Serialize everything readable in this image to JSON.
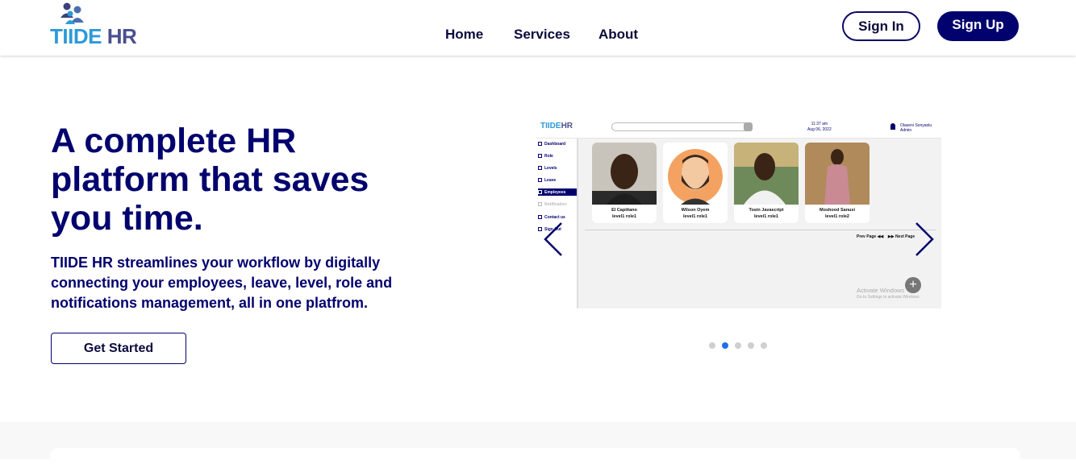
{
  "header": {
    "logo_part1": "TIIDE",
    "logo_part2": "HR",
    "nav": [
      "Home",
      "Services",
      "About"
    ],
    "signin_label": "Sign In",
    "signup_label": "Sign Up"
  },
  "hero": {
    "title": "A complete HR platform that saves you time.",
    "description": "TIIDE HR streamlines your workflow by digitally connecting your employees, leave, level, role and notifications management, all in one platfrom.",
    "cta_label": "Get Started"
  },
  "carousel": {
    "active_index": 1,
    "dot_count": 5,
    "slide": {
      "logo_part1": "TIIDE",
      "logo_part2": "HR",
      "time": "11:37 am",
      "date": "Aug 06, 2022",
      "user_name": "Olaseni Sonyaolu",
      "user_role": "Admin",
      "sidebar": [
        "Dashboard",
        "Role",
        "Levels",
        "Leave",
        "Employees",
        "Notification",
        "Contact us",
        "Sign Out"
      ],
      "employees": [
        {
          "name": "El Capiitano",
          "role": "level1 role1"
        },
        {
          "name": "Wilson Oyem",
          "role": "level1 role1"
        },
        {
          "name": "Tosin Javascript",
          "role": "level1 role1"
        },
        {
          "name": "Moshood Sanusi",
          "role": "level1 role2"
        }
      ],
      "prev_page": "Prev Page",
      "next_page": "Next Page",
      "watermark_title": "Activate Windows",
      "watermark_sub": "Go to Settings to activate Windows."
    }
  },
  "colors": {
    "navy": "#02026e",
    "logo_blue": "#2c9ad8",
    "logo_purple": "#4a4f8f",
    "dot_active": "#1a73e8"
  }
}
